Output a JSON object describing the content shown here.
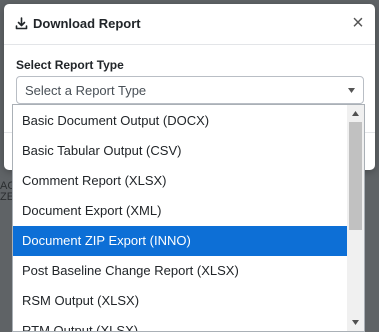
{
  "modal": {
    "title": "Download Report",
    "field_label": "Select Report Type",
    "select_placeholder": "Select a Report Type"
  },
  "dropdown": {
    "options": [
      "Basic Document Output (DOCX)",
      "Basic Tabular Output (CSV)",
      "Comment Report (XLSX)",
      "Document Export (XML)",
      "Document ZIP Export (INNO)",
      "Post Baseline Change Report (XLSX)",
      "RSM Output (XLSX)",
      "RTM Output (XLSX)"
    ],
    "selected_index": 4
  },
  "colors": {
    "overlay": "#5f6366",
    "selected": "#0d6fd6"
  },
  "icons": [
    "download-icon",
    "close-icon",
    "caret-down-icon",
    "scroll-up-icon",
    "scroll-down-icon"
  ]
}
